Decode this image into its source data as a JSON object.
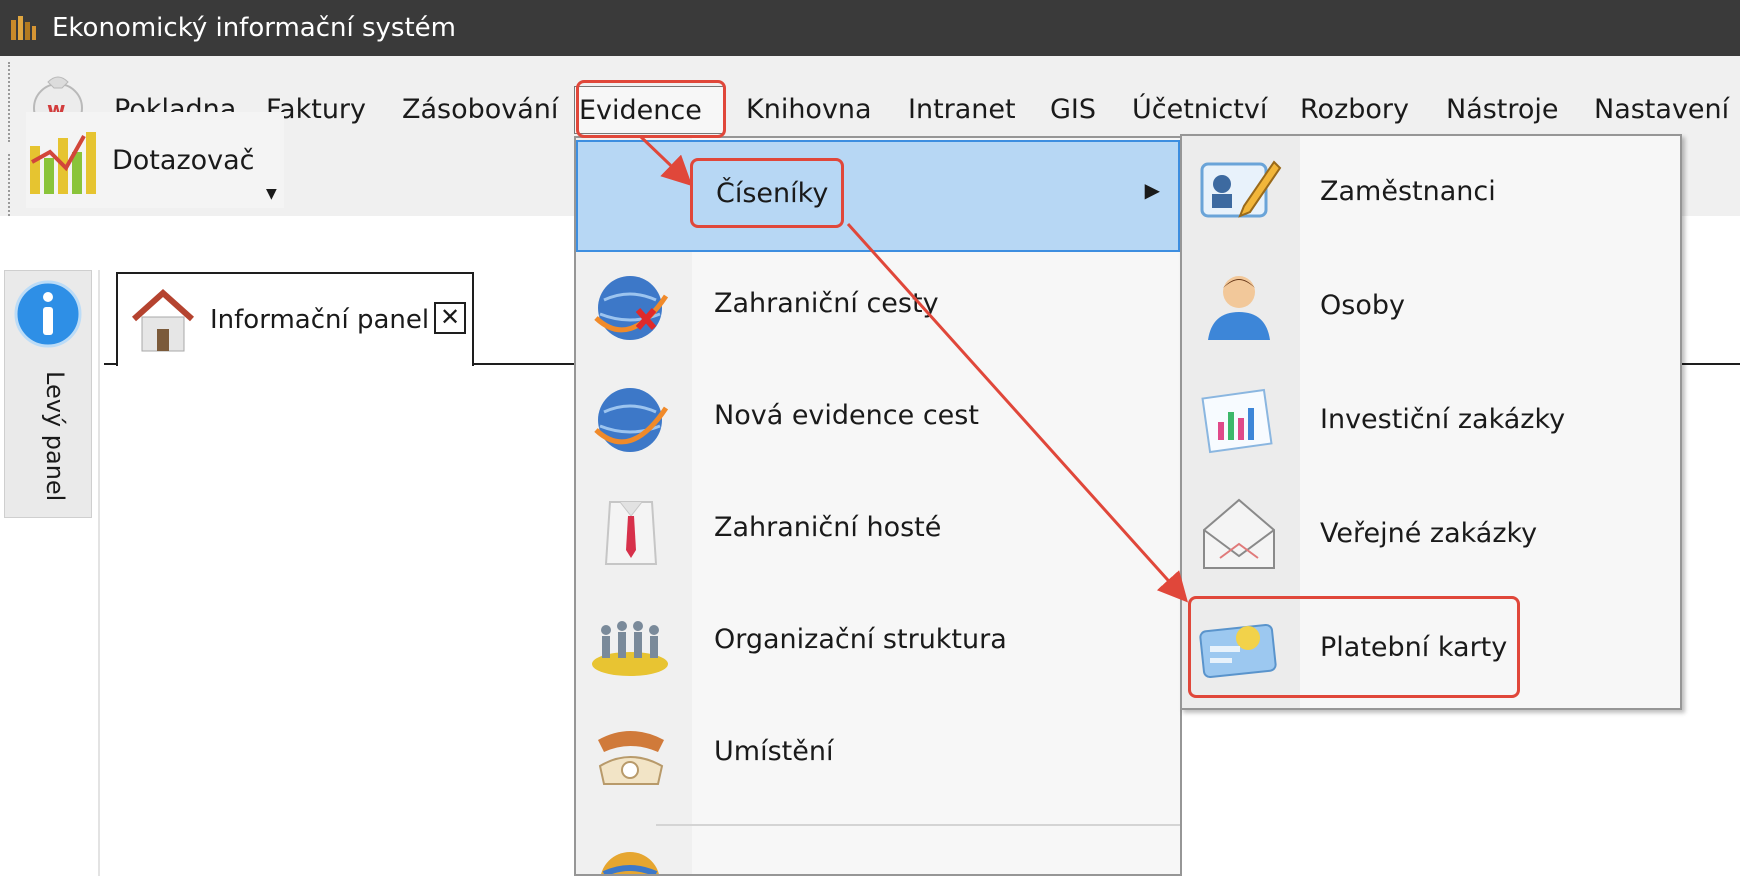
{
  "window": {
    "title": "Ekonomický informační systém"
  },
  "menubar": {
    "items": [
      {
        "label": "Pokladna"
      },
      {
        "label": "Faktury"
      },
      {
        "label": "Zásobování"
      },
      {
        "label": "Evidence"
      },
      {
        "label": "Knihovna"
      },
      {
        "label": "Intranet"
      },
      {
        "label": "GIS"
      },
      {
        "label": "Účetnictví"
      },
      {
        "label": "Rozbory"
      },
      {
        "label": "Nástroje"
      },
      {
        "label": "Nastavení"
      }
    ],
    "selected": "Evidence"
  },
  "toolbar": {
    "query_label": "Dotazovač"
  },
  "left_panel": {
    "label": "Levý panel"
  },
  "doc_tab": {
    "label": "Informační panel",
    "close": "✕"
  },
  "evidence_menu": {
    "items": [
      {
        "label": "Číseníky",
        "icon": "blank",
        "has_submenu": true
      },
      {
        "label": "Zahraniční cesty",
        "icon": "globe-x-icon"
      },
      {
        "label": "Nová evidence cest",
        "icon": "globe-icon"
      },
      {
        "label": "Zahraniční hosté",
        "icon": "shirt-tie-icon"
      },
      {
        "label": "Organizační struktura",
        "icon": "people-platform-icon"
      },
      {
        "label": "Umístění",
        "icon": "telephone-icon"
      }
    ],
    "submenu_arrow": "▶"
  },
  "ciseniky_submenu": {
    "items": [
      {
        "label": "Zaměstnanci",
        "icon": "id-card-pencil-icon"
      },
      {
        "label": "Osoby",
        "icon": "person-icon"
      },
      {
        "label": "Investiční zakázky",
        "icon": "chart-paper-icon"
      },
      {
        "label": "Veřejné zakázky",
        "icon": "envelope-icon"
      },
      {
        "label": "Platební karty",
        "icon": "payment-card-icon"
      }
    ]
  },
  "colors": {
    "titlebar": "#3a3a3a",
    "highlight_fill": "#b7d7f4",
    "highlight_border": "#3d8ee0",
    "annotation": "#e0473a"
  }
}
